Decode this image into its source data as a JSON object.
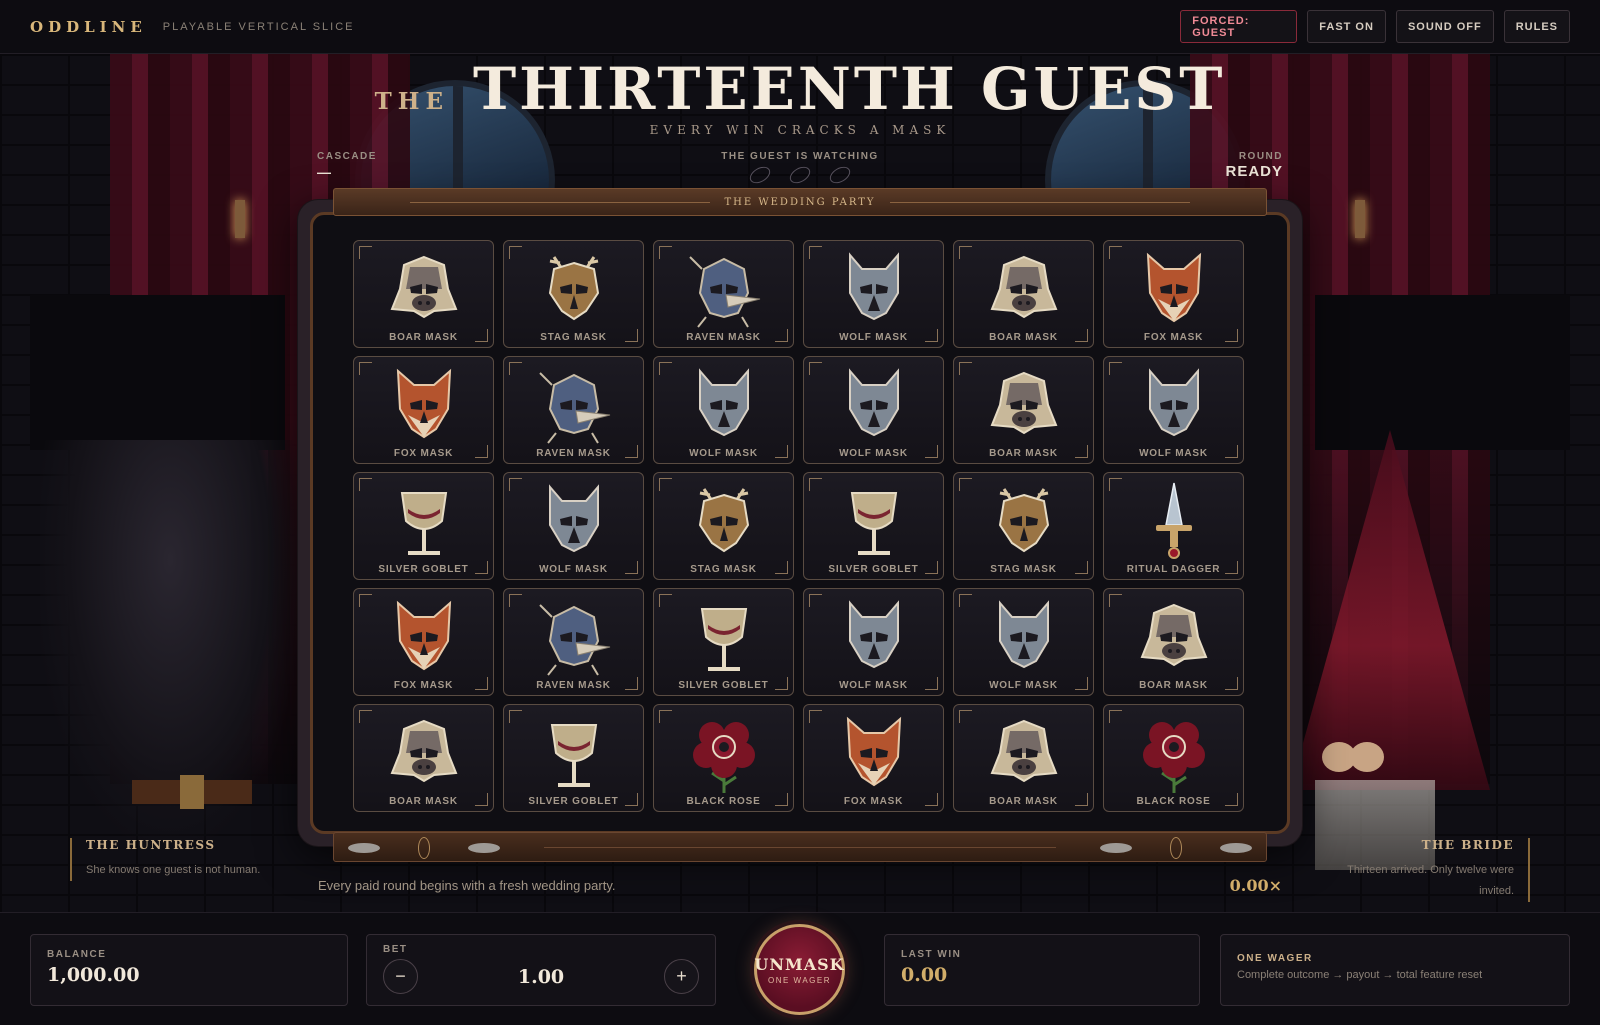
{
  "topbar": {
    "brand": "ODDLINE",
    "subtitle": "PLAYABLE VERTICAL SLICE",
    "forced_label": "FORCED: GUEST",
    "fast_label": "FAST ON",
    "sound_label": "SOUND OFF",
    "rules_label": "RULES"
  },
  "title": {
    "prefix": "THE",
    "main": "THIRTEENTH GUEST",
    "tagline": "EVERY WIN CRACKS A MASK"
  },
  "hud": {
    "cascade_label": "CASCADE",
    "cascade_value": "—",
    "watching_label": "THE GUEST IS WATCHING",
    "round_label": "ROUND",
    "round_value": "READY"
  },
  "board": {
    "header": "THE WEDDING PARTY",
    "rows": [
      [
        {
          "symbol": "boar",
          "label": "BOAR MASK"
        },
        {
          "symbol": "stag",
          "label": "STAG MASK"
        },
        {
          "symbol": "raven",
          "label": "RAVEN MASK"
        },
        {
          "symbol": "wolf",
          "label": "WOLF MASK"
        },
        {
          "symbol": "boar",
          "label": "BOAR MASK"
        },
        {
          "symbol": "fox",
          "label": "FOX MASK"
        }
      ],
      [
        {
          "symbol": "fox",
          "label": "FOX MASK"
        },
        {
          "symbol": "raven",
          "label": "RAVEN MASK"
        },
        {
          "symbol": "wolf",
          "label": "WOLF MASK"
        },
        {
          "symbol": "wolf",
          "label": "WOLF MASK"
        },
        {
          "symbol": "boar",
          "label": "BOAR MASK"
        },
        {
          "symbol": "wolf",
          "label": "WOLF MASK"
        }
      ],
      [
        {
          "symbol": "goblet",
          "label": "SILVER GOBLET"
        },
        {
          "symbol": "wolf",
          "label": "WOLF MASK"
        },
        {
          "symbol": "stag",
          "label": "STAG MASK"
        },
        {
          "symbol": "goblet",
          "label": "SILVER GOBLET"
        },
        {
          "symbol": "stag",
          "label": "STAG MASK"
        },
        {
          "symbol": "dagger",
          "label": "RITUAL DAGGER"
        }
      ],
      [
        {
          "symbol": "fox",
          "label": "FOX MASK"
        },
        {
          "symbol": "raven",
          "label": "RAVEN MASK"
        },
        {
          "symbol": "goblet",
          "label": "SILVER GOBLET"
        },
        {
          "symbol": "wolf",
          "label": "WOLF MASK"
        },
        {
          "symbol": "wolf",
          "label": "WOLF MASK"
        },
        {
          "symbol": "boar",
          "label": "BOAR MASK"
        }
      ],
      [
        {
          "symbol": "boar",
          "label": "BOAR MASK"
        },
        {
          "symbol": "goblet",
          "label": "SILVER GOBLET"
        },
        {
          "symbol": "rose",
          "label": "BLACK ROSE"
        },
        {
          "symbol": "fox",
          "label": "FOX MASK"
        },
        {
          "symbol": "boar",
          "label": "BOAR MASK"
        },
        {
          "symbol": "rose",
          "label": "BLACK ROSE"
        }
      ]
    ]
  },
  "characters": {
    "left": {
      "name": "THE HUNTRESS",
      "desc": "She knows one guest is not human."
    },
    "right": {
      "name": "THE BRIDE",
      "desc": "Thirteen arrived. Only twelve were invited."
    }
  },
  "status": {
    "message": "Every paid round begins with a fresh wedding party.",
    "multiplier": "0.00×"
  },
  "bottom": {
    "balance_label": "BALANCE",
    "balance_value": "1,000.00",
    "bet_label": "BET",
    "bet_minus": "−",
    "bet_value": "1.00",
    "bet_plus": "+",
    "unmask_label": "UNMASK",
    "unmask_sub": "ONE WAGER",
    "lastwin_label": "LAST WIN",
    "lastwin_value": "0.00",
    "wager_title": "ONE WAGER",
    "wager_desc": "Complete outcome → payout → total feature reset"
  },
  "colors": {
    "accent_gold": "#d2ae6a",
    "forced_red": "#f08a96",
    "unmask_crimson": "#8a1c34"
  }
}
